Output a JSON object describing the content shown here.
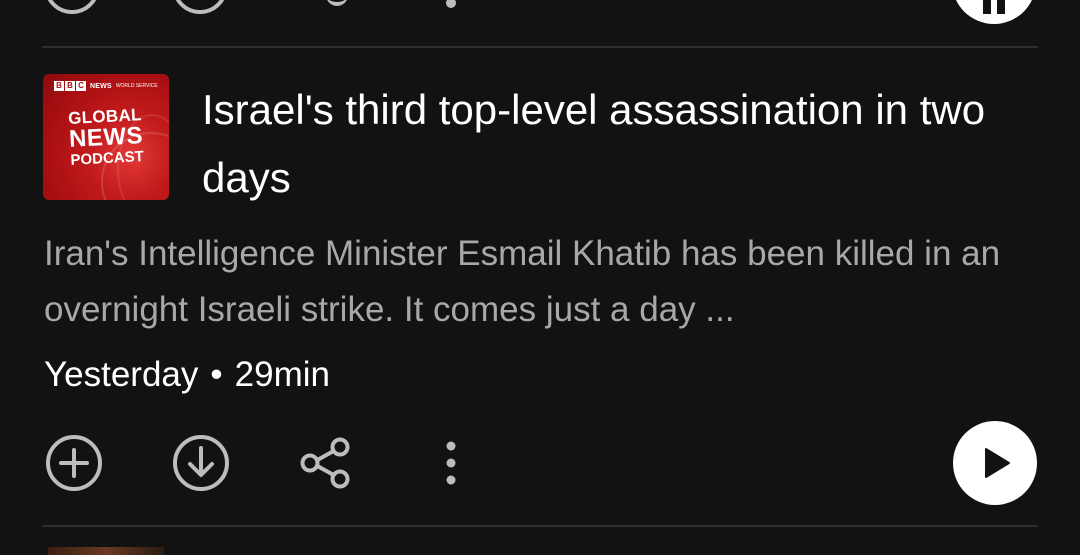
{
  "episode": {
    "artwork": {
      "bbc_letters": [
        "B",
        "B",
        "C"
      ],
      "network": "NEWS",
      "service": "WORLD SERVICE",
      "line1": "GLOBAL",
      "line2": "NEWS",
      "line3": "PODCAST"
    },
    "title": "Israel's third top-level assassination in two days",
    "description": "Iran's Intelligence Minister Esmail Khatib has been killed in an overnight Israeli strike. It comes just a day ...",
    "date": "Yesterday",
    "separator": "•",
    "duration": "29min"
  },
  "actions": {
    "add_icon": "plus-circle-icon",
    "download_icon": "download-circle-icon",
    "share_icon": "share-icon",
    "more_icon": "more-vertical-icon",
    "play_icon": "play-icon"
  },
  "colors": {
    "background": "#121212",
    "primary_text": "#ffffff",
    "secondary_text": "#a8a8a8",
    "icon": "#bdbdbd",
    "divider": "#2e2e2e",
    "artwork_red": "#b5121b"
  }
}
